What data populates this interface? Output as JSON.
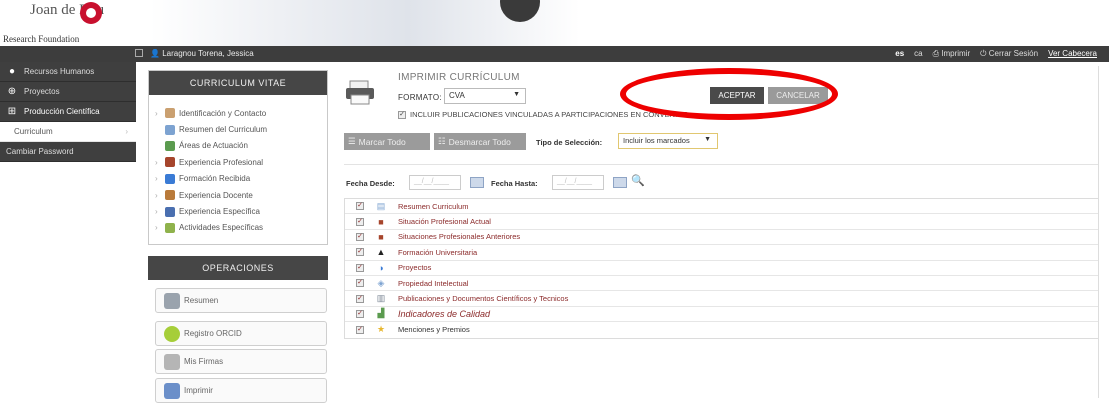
{
  "logo": {
    "text": "Joan de Déu",
    "subtitle": "Research Foundation"
  },
  "topbar": {
    "user": "Laragnou Torena, Jessica",
    "lang": "es",
    "lang_alt": "ca",
    "print": "Imprimir",
    "logout": "Cerrar Sesión",
    "header_link": "Ver Cabecera"
  },
  "sidebar": {
    "items": [
      {
        "label": "Recursos Humanos",
        "icon": "person-icon"
      },
      {
        "label": "Proyectos",
        "icon": "globe-icon"
      },
      {
        "label": "Producción Científica",
        "icon": "hierarchy-icon"
      },
      {
        "label": "Curriculum",
        "icon": ""
      },
      {
        "label": "Cambiar Password",
        "icon": ""
      }
    ]
  },
  "cv_panel": {
    "title": "CURRICULUM VITAE",
    "items": [
      {
        "label": "Identificación y Contacto",
        "color": "#caa070"
      },
      {
        "label": "Resumen del Curriculum",
        "color": "#7da3d1"
      },
      {
        "label": "Áreas de Actuación",
        "color": "#5b9b4f"
      },
      {
        "label": "Experiencia Profesional",
        "color": "#a6452c"
      },
      {
        "label": "Formación Recibida",
        "color": "#3a7bd5"
      },
      {
        "label": "Experiencia Docente",
        "color": "#b97a3a"
      },
      {
        "label": "Experiencia Específica",
        "color": "#4a6fb0"
      },
      {
        "label": "Actividades Específicas",
        "color": "#8fb24c"
      }
    ]
  },
  "operations": {
    "title": "OPERACIONES",
    "buttons": [
      {
        "label": "Resumen",
        "color": "#9aa3ad"
      },
      {
        "label": "Registro ORCID",
        "color": "#a6ce39"
      },
      {
        "label": "Mis Firmas",
        "color": "#b5b5b5"
      },
      {
        "label": "Imprimir",
        "color": "#6b8fc9"
      }
    ]
  },
  "main": {
    "title": "IMPRIMIR CURRÍCULUM",
    "format_label": "FORMATO:",
    "format_value": "CVA",
    "include_text": "INCLUIR PUBLICACIONES VINCULADAS A PARTICIPACIONES EN CONVENIOS",
    "accept": "ACEPTAR",
    "cancel": "CANCELAR",
    "mark_all": "Marcar Todo",
    "unmark_all": "Desmarcar Todo",
    "selection_label": "Tipo de Selección:",
    "selection_value": "Incluir los marcados",
    "date_from_label": "Fecha Desde:",
    "date_to_label": "Fecha Hasta:",
    "date_placeholder": "__/__/____"
  },
  "sections": [
    {
      "label": "Resumen Curriculum",
      "icon": "document-icon",
      "color": "#7da3d1",
      "glyph": "▤"
    },
    {
      "label": "Situación Profesional Actual",
      "icon": "briefcase-icon",
      "color": "#a6452c",
      "glyph": "■"
    },
    {
      "label": "Situaciones Profesionales Anteriores",
      "icon": "briefcase-icon",
      "color": "#a6452c",
      "glyph": "■"
    },
    {
      "label": "Formación Universitaria",
      "icon": "graduation-cap-icon",
      "color": "#222222",
      "glyph": "▲"
    },
    {
      "label": "Proyectos",
      "icon": "pie-icon",
      "color": "#3a7bd5",
      "glyph": "◑"
    },
    {
      "label": "Propiedad Intelectual",
      "icon": "patent-icon",
      "color": "#7da3d1",
      "glyph": "◈"
    },
    {
      "label": "Publicaciones y Documentos Científicos y Tecnicos",
      "icon": "books-icon",
      "color": "#7d8896",
      "glyph": "▥"
    },
    {
      "label": "Indicadores de Calidad",
      "icon": "chart-icon",
      "color": "#5b9b4f",
      "glyph": "▟"
    },
    {
      "label": "Menciones y Premios",
      "icon": "star-icon",
      "color": "#e8b730",
      "glyph": "★"
    }
  ]
}
